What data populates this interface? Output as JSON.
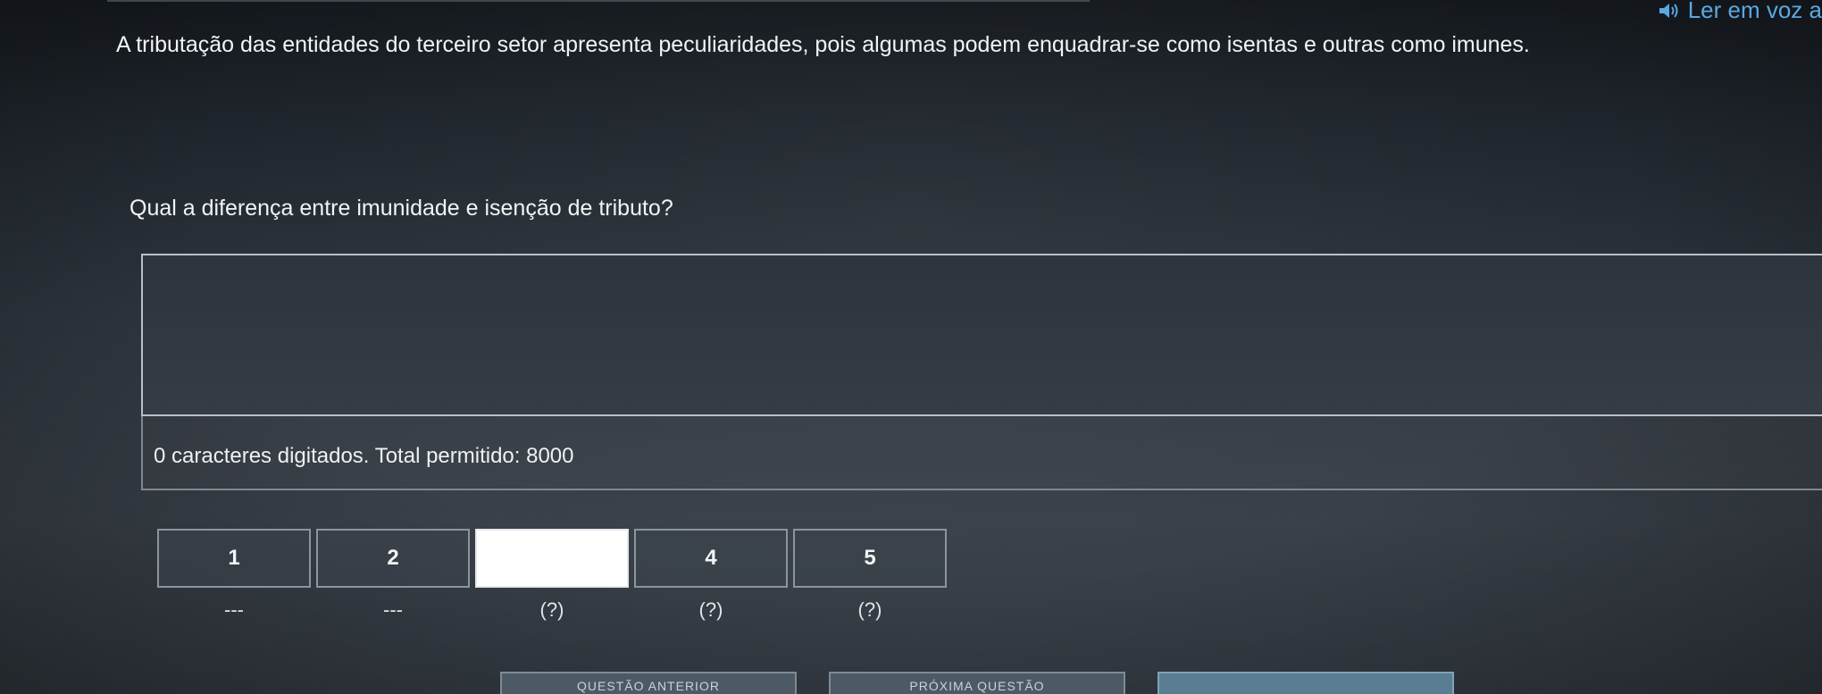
{
  "header": {
    "read_aloud_label": "Ler em voz a",
    "read_aloud_icon": "speaker-icon"
  },
  "question": {
    "statement": "A tributação das entidades do terceiro setor apresenta peculiaridades, pois algumas podem enquadrar-se como isentas e outras como imunes.",
    "prompt": "Qual a diferença entre imunidade e isenção de tributo?"
  },
  "answer": {
    "value": "",
    "counter_text": "0 caracteres digitados. Total permitido: 8000"
  },
  "pager": {
    "items": [
      {
        "label": "1",
        "status": "---",
        "current": false
      },
      {
        "label": "2",
        "status": "---",
        "current": false
      },
      {
        "label": "",
        "status": "(?)",
        "current": true
      },
      {
        "label": "4",
        "status": "(?)",
        "current": false
      },
      {
        "label": "5",
        "status": "(?)",
        "current": false
      }
    ]
  },
  "footer": {
    "prev_label": "QUESTÃO ANTERIOR",
    "next_label": "PRÓXIMA QUESTÃO",
    "submit_label": ""
  },
  "colors": {
    "accent": "#5aa8e0",
    "background": "#2e353d"
  }
}
